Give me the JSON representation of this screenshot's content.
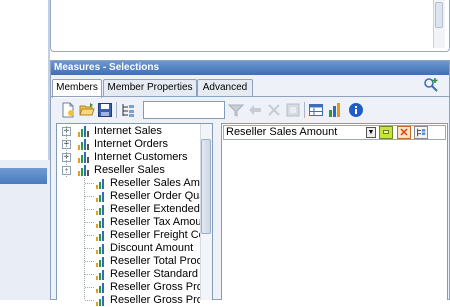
{
  "dialog": {
    "title": "Measures - Selections",
    "tabs": [
      {
        "label": "Members",
        "active": true
      },
      {
        "label": "Member Properties",
        "active": false
      },
      {
        "label": "Advanced",
        "active": false
      }
    ]
  },
  "toolbar": {
    "search_value": "",
    "icons": [
      "new-icon",
      "open-folder-icon",
      "save-icon",
      "hierarchy-icon",
      "search-field",
      "filter-icon",
      "nav-icon",
      "disabled-icon",
      "table-icon",
      "chart-icon",
      "info-icon"
    ]
  },
  "tree": {
    "items": [
      {
        "label": "Internet Sales",
        "level": 1,
        "expander": "+"
      },
      {
        "label": "Internet Orders",
        "level": 1,
        "expander": "+"
      },
      {
        "label": "Internet Customers",
        "level": 1,
        "expander": "+"
      },
      {
        "label": "Reseller Sales",
        "level": 1,
        "expander": "-"
      },
      {
        "label": "Reseller Sales Amount",
        "level": 2
      },
      {
        "label": "Reseller Order Quantity",
        "level": 2
      },
      {
        "label": "Reseller Extended Amo",
        "level": 2
      },
      {
        "label": "Reseller Tax Amount",
        "level": 2
      },
      {
        "label": "Reseller Freight Cost",
        "level": 2
      },
      {
        "label": "Discount Amount",
        "level": 2
      },
      {
        "label": "Reseller Total Product C",
        "level": 2
      },
      {
        "label": "Reseller Standard Produ",
        "level": 2
      },
      {
        "label": "Reseller Gross Profit",
        "level": 2
      },
      {
        "label": "Reseller Gross Profit M",
        "level": 2
      }
    ]
  },
  "selection": {
    "value": "Reseller Sales Amount",
    "cancel_glyph": "✕",
    "dropdown_glyph": "▼"
  },
  "colors": {
    "title_bar": "#4f7fc0",
    "dialog_bg": "#eef2f8",
    "border": "#8ea2be"
  }
}
